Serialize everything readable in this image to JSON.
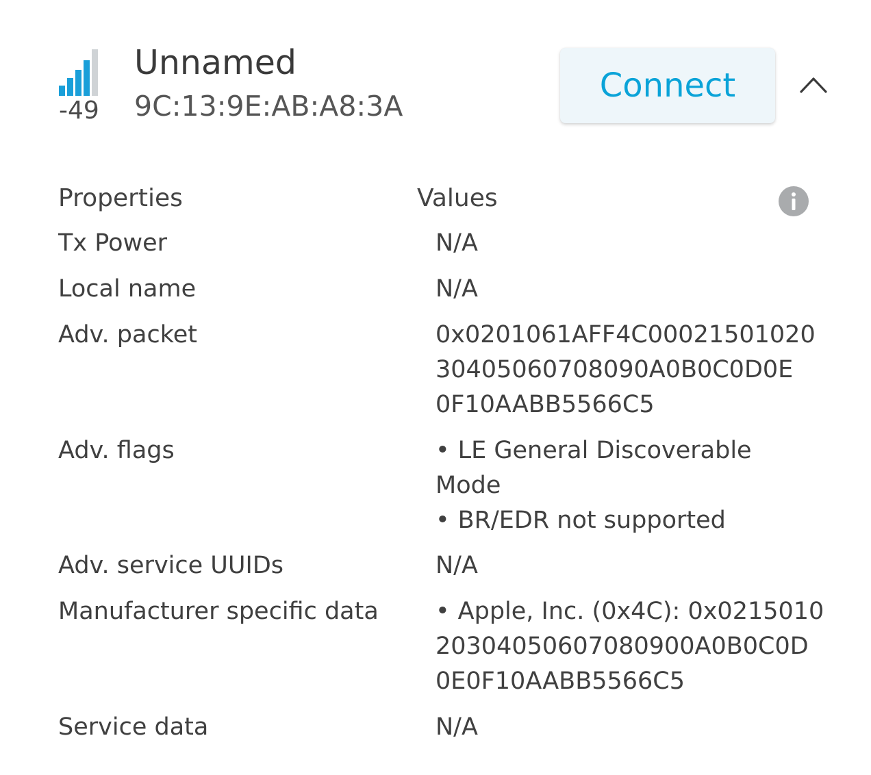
{
  "device": {
    "name": "Unnamed",
    "address": "9C:13:9E:AB:A8:3A",
    "rssi": "-49",
    "signal_bars_filled": 4,
    "signal_bars_total": 5
  },
  "actions": {
    "connect_label": "Connect"
  },
  "table": {
    "properties_header": "Properties",
    "values_header": "Values",
    "rows": [
      {
        "property": "Tx Power",
        "value_lines": [
          "N/A"
        ]
      },
      {
        "property": "Local name",
        "value_lines": [
          "N/A"
        ]
      },
      {
        "property": "Adv. packet",
        "value_lines": [
          "0x0201061AFF4C00021501020",
          "30405060708090A0B0C0D0E",
          "0F10AABB5566C5"
        ]
      },
      {
        "property": "Adv. flags",
        "value_lines": [
          "LE General Discoverable",
          "Mode",
          "BR/EDR not supported"
        ]
      },
      {
        "property": "Adv. service UUIDs",
        "value_lines": [
          "N/A"
        ]
      },
      {
        "property": "Manufacturer specific data",
        "value_lines": [
          "Apple, Inc. (0x4C): 0x0215010",
          "20304050607080900A0B0C0D",
          "0E0F10AABB5566C5"
        ]
      },
      {
        "property": "Service data",
        "value_lines": [
          "N/A"
        ]
      }
    ]
  },
  "colors": {
    "accent": "#0aa3d8",
    "signal_active": "#1a9fd9",
    "signal_inactive": "#cfd3d6",
    "button_bg": "#eef6fa",
    "info_icon": "#a9abad"
  },
  "icons": {
    "signal": "signal-strength-icon",
    "collapse": "chevron-up-icon",
    "info": "info-icon"
  }
}
